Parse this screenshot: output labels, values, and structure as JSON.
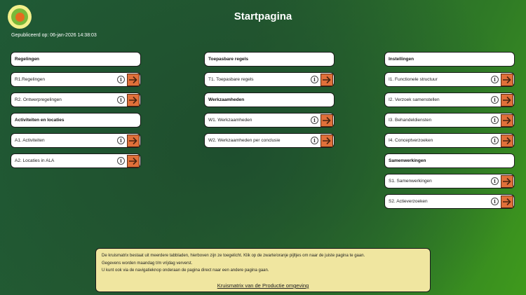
{
  "header": {
    "title": "Startpagina",
    "published": "Gepubliceerd op: 06-jan-2026 14:38:03",
    "logo_icon": "circle-logo-icon"
  },
  "columns": [
    {
      "sections": [
        {
          "header": "Regelingen",
          "items": [
            "R1.Regelingen",
            "R2. Ontwerpregelingen"
          ]
        },
        {
          "header": "Activiteiten en locaties",
          "items": [
            "A1. Activiteiten",
            "A2. Locaties in ALA"
          ]
        }
      ]
    },
    {
      "sections": [
        {
          "header": "Toepasbare regels",
          "items": [
            "T1. Toepasbare regels"
          ]
        },
        {
          "header": "Werkzaamheden",
          "items": [
            "W1. Werkzaamheden",
            "W2. Werkzaamheden per conclusie"
          ]
        }
      ]
    },
    {
      "sections": [
        {
          "header": "Instellingen",
          "items": [
            "I1. Functionele structuur",
            "I2. Verzoek samenstellen",
            "I3. Behandeldiensten",
            "I4. Conceptverzoeken"
          ]
        },
        {
          "header": "Samenwerkingen",
          "items": [
            "S1. Samenwerkingen",
            "S2. Actieverzoeken"
          ]
        }
      ]
    }
  ],
  "info_panel": {
    "line1": "De kruismatrix bestaat uit meerdere tabbladen, hierboven zijn ze toegelicht. Klik op de zwarte/oranje pijltjes om naar de juiste pagina te gaan.",
    "line2": "Gegevens worden maandag t/m vrijdag ververst.",
    "line3": "U kunt ook via de navigatieknop onderaan de pagina direct naar een andere pagina gaan.",
    "link": "Kruismatrix van de Productie omgeving"
  },
  "colors": {
    "accent": "#e0703a",
    "panel": "#f0e6a0",
    "background_dark": "#1e4e2e",
    "background_light": "#3f9a1c"
  },
  "icons": {
    "info": "info-icon",
    "arrow": "arrow-right-icon"
  }
}
